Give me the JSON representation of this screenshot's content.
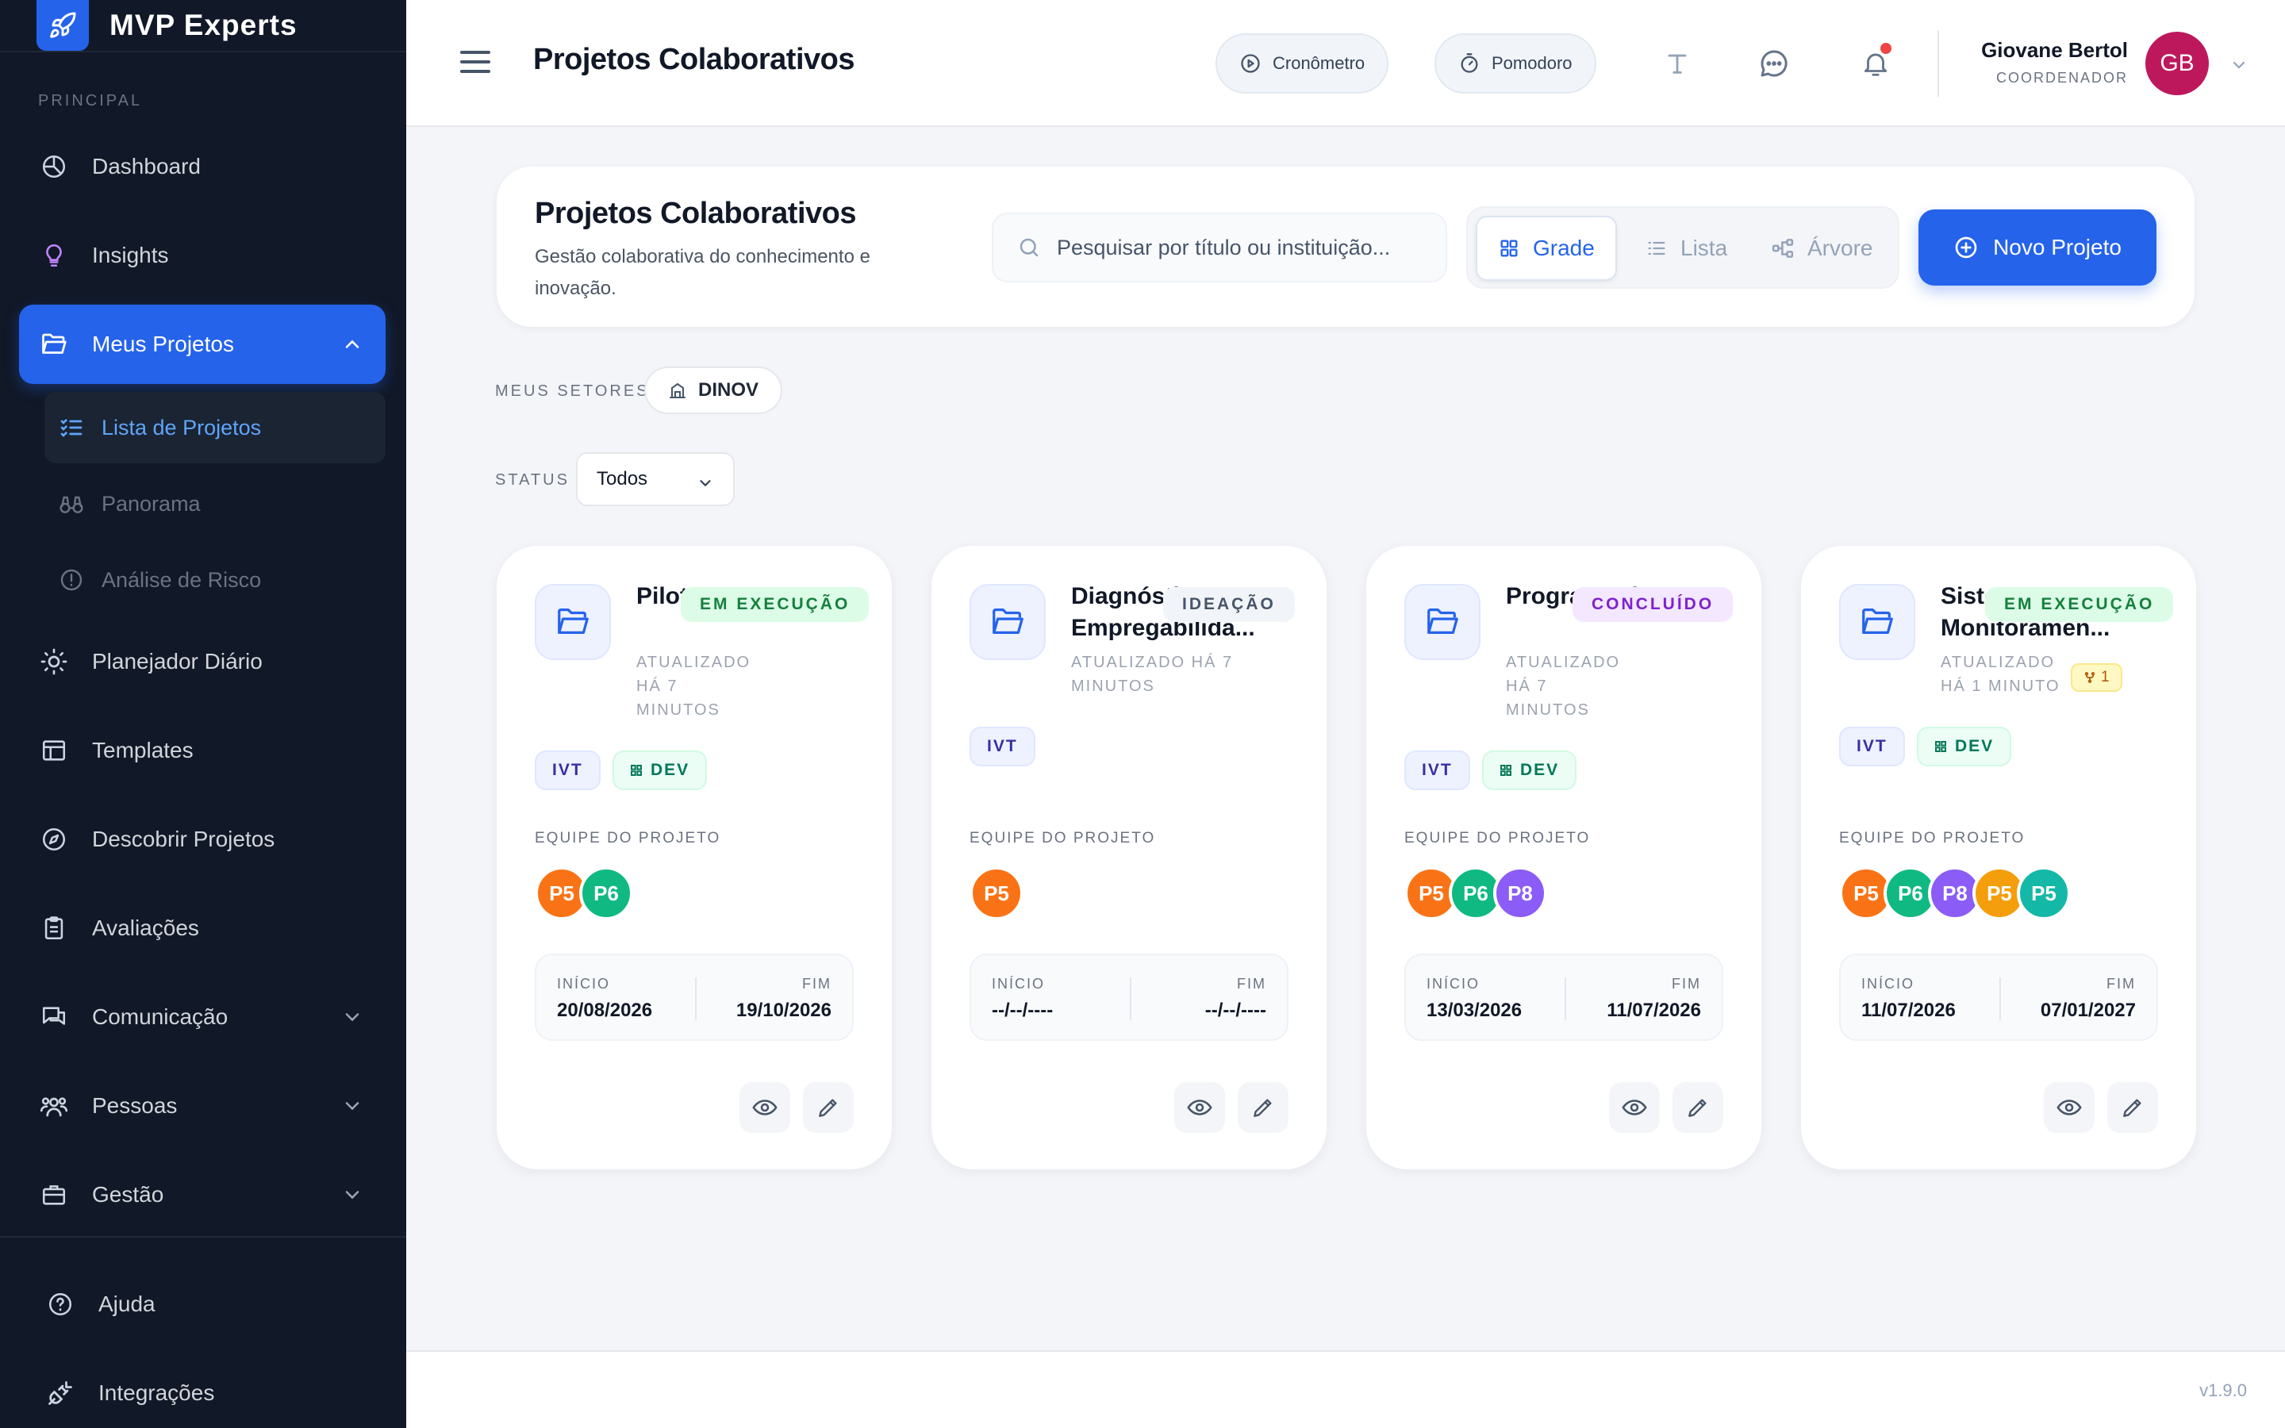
{
  "brand": {
    "name": "MVP Experts",
    "logo_icon": "rocket-icon"
  },
  "sidebar": {
    "section_label": "PRINCIPAL",
    "items": [
      {
        "label": "Dashboard",
        "icon": "chart-pie-icon"
      },
      {
        "label": "Insights",
        "icon": "lightbulb-icon"
      },
      {
        "label": "Meus Projetos",
        "icon": "folder-open-icon",
        "active": true
      },
      {
        "label": "Planejador Diário",
        "icon": "sun-icon"
      },
      {
        "label": "Templates",
        "icon": "layout-icon"
      },
      {
        "label": "Descobrir Projetos",
        "icon": "compass-icon"
      },
      {
        "label": "Avaliações",
        "icon": "clipboard-icon"
      },
      {
        "label": "Comunicação",
        "icon": "messages-icon"
      },
      {
        "label": "Pessoas",
        "icon": "users-icon"
      },
      {
        "label": "Gestão",
        "icon": "briefcase-icon"
      }
    ],
    "subitems": [
      {
        "label": "Lista de Projetos",
        "icon": "list-check-icon",
        "active": true
      },
      {
        "label": "Panorama",
        "icon": "binoculars-icon"
      },
      {
        "label": "Análise de Risco",
        "icon": "alert-circle-icon"
      }
    ],
    "bottom": [
      {
        "label": "Ajuda",
        "icon": "help-circle-icon"
      },
      {
        "label": "Integrações",
        "icon": "plug-icon"
      }
    ]
  },
  "topbar": {
    "title": "Projetos Colaborativos",
    "cronometro": "Cronômetro",
    "pomodoro": "Pomodoro",
    "user": {
      "name": "Giovane Bertol",
      "role": "COORDENADOR",
      "initials": "GB"
    }
  },
  "header": {
    "title": "Projetos Colaborativos",
    "subtitle": "Gestão colaborativa do conhecimento e inovação.",
    "search_placeholder": "Pesquisar por título ou instituição...",
    "views": {
      "grid": "Grade",
      "list": "Lista",
      "tree": "Árvore"
    },
    "new_project": "Novo Projeto"
  },
  "filters": {
    "sectors_label": "MEUS SETORES",
    "sector": "DINOV",
    "status_label": "STATUS",
    "status_value": "Todos"
  },
  "card_labels": {
    "team": "EQUIPE DO PROJETO",
    "start": "INÍCIO",
    "end": "FIM"
  },
  "projects": [
    {
      "title": "Piloto Sensor...",
      "badge": "EM EXECUÇÃO",
      "updated": [
        "ATUALIZADO",
        "HÁ 7",
        "MINUTOS"
      ],
      "tags": [
        "IVT",
        "DEV"
      ],
      "team": [
        "P5",
        "P6"
      ],
      "start": "20/08/2026",
      "end": "19/10/2026"
    },
    {
      "title": "Diagnóstico Empregabilida...",
      "badge": "IDEAÇÃO",
      "updated": [
        "ATUALIZADO HÁ 7",
        "MINUTOS"
      ],
      "tags": [
        "IVT"
      ],
      "team": [
        "P5"
      ],
      "start": "--/--/----",
      "end": "--/--/----"
    },
    {
      "title": "Programa de...",
      "badge": "CONCLUÍDO",
      "updated": [
        "ATUALIZADO",
        "HÁ 7",
        "MINUTOS"
      ],
      "tags": [
        "IVT",
        "DEV"
      ],
      "team": [
        "P5",
        "P6",
        "P8"
      ],
      "start": "13/03/2026",
      "end": "11/07/2026"
    },
    {
      "title": "Sistema Monitoramen...",
      "badge": "EM EXECUÇÃO",
      "updated": [
        "ATUALIZADO",
        "HÁ 1 MINUTO"
      ],
      "fork_count": "1",
      "tags": [
        "IVT",
        "DEV"
      ],
      "team": [
        "P5",
        "P6",
        "P8",
        "P5",
        "P5"
      ],
      "start": "11/07/2026",
      "end": "07/01/2027"
    }
  ],
  "colors": {
    "accent": "#2563eb",
    "sidebar_bg": "#111827",
    "avatar_P5": "#f97316",
    "avatar_P6": "#10b981",
    "avatar_P8": "#8b5cf6",
    "avatar_P5_alt": "#f59e0b",
    "avatar_P5_teal": "#14b8a6"
  },
  "footer": {
    "version": "v1.9.0"
  }
}
